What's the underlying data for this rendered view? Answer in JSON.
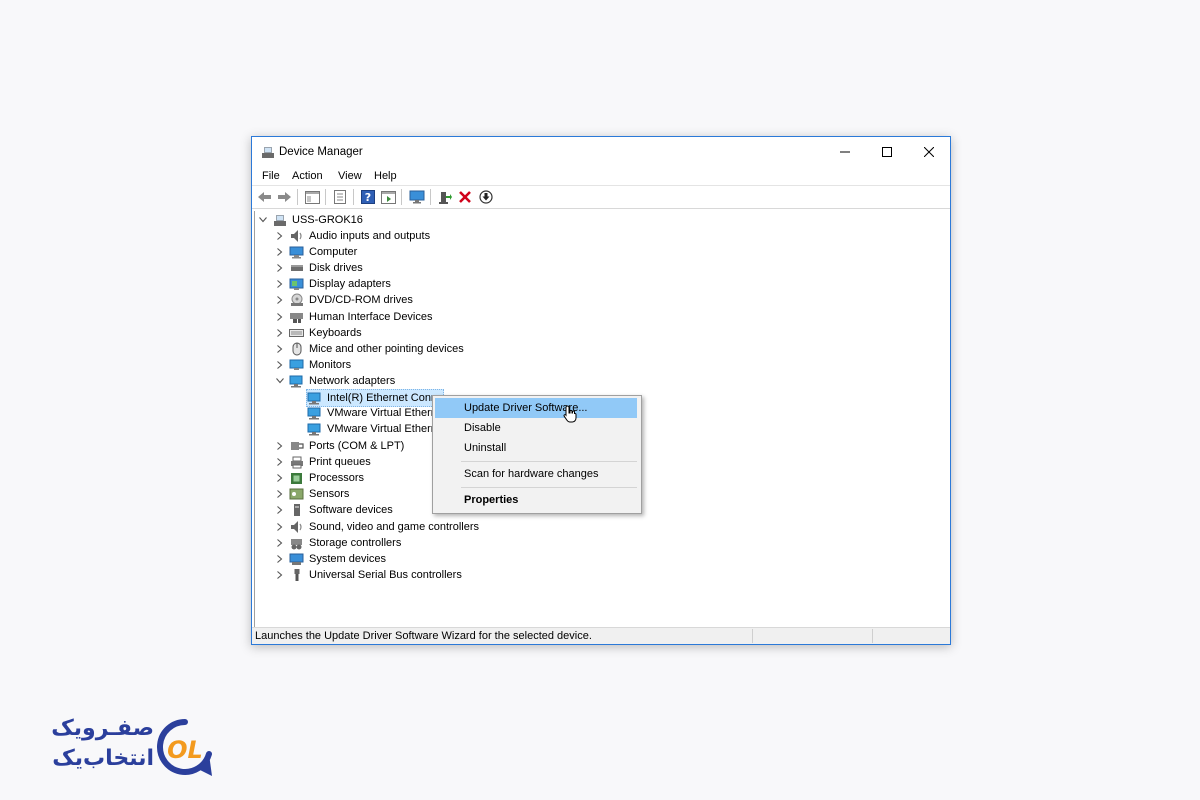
{
  "window": {
    "title": "Device Manager"
  },
  "menu": [
    "File",
    "Action",
    "View",
    "Help"
  ],
  "toolbar": [
    "back-icon",
    "forward-icon",
    "properties-icon",
    "scan-icon",
    "help-icon",
    "action-icon",
    "monitor-icon",
    "update-driver-icon",
    "uninstall-icon",
    "download-icon"
  ],
  "tree": {
    "root": "USS-GROK16",
    "items": [
      {
        "label": "Audio inputs and outputs",
        "icon": "speaker-icon"
      },
      {
        "label": "Computer",
        "icon": "computer-icon"
      },
      {
        "label": "Disk drives",
        "icon": "disk-drive-icon"
      },
      {
        "label": "Display adapters",
        "icon": "display-adapter-icon"
      },
      {
        "label": "DVD/CD-ROM drives",
        "icon": "dvd-drive-icon"
      },
      {
        "label": "Human Interface Devices",
        "icon": "hid-icon"
      },
      {
        "label": "Keyboards",
        "icon": "keyboard-icon"
      },
      {
        "label": "Mice and other pointing devices",
        "icon": "mouse-icon"
      },
      {
        "label": "Monitors",
        "icon": "monitor-icon"
      },
      {
        "label": "Network adapters",
        "icon": "network-adapter-icon"
      }
    ],
    "network_children": [
      "Intel(R) Ethernet Conn",
      "VMware Virtual Ethern",
      "VMware Virtual Ethern"
    ],
    "items_after": [
      {
        "label": "Ports (COM & LPT)",
        "icon": "port-icon"
      },
      {
        "label": "Print queues",
        "icon": "printer-icon"
      },
      {
        "label": "Processors",
        "icon": "processor-icon"
      },
      {
        "label": "Sensors",
        "icon": "sensor-icon"
      },
      {
        "label": "Software devices",
        "icon": "software-device-icon"
      },
      {
        "label": "Sound, video and game controllers",
        "icon": "speaker-icon"
      },
      {
        "label": "Storage controllers",
        "icon": "storage-icon"
      },
      {
        "label": "System devices",
        "icon": "system-icon"
      },
      {
        "label": "Universal Serial Bus controllers",
        "icon": "usb-icon"
      }
    ]
  },
  "context_menu": {
    "update": "Update Driver Software...",
    "disable": "Disable",
    "uninstall": "Uninstall",
    "scan": "Scan for hardware changes",
    "properties": "Properties"
  },
  "status": "Launches the Update Driver Software Wizard for the selected device.",
  "logo": {
    "line1": "صفـرویک",
    "line2": "انتخاب‌یک",
    "mark": "OL"
  },
  "colors": {
    "accent": "#2b79d8",
    "highlight": "#91c9f7",
    "selection": "#cce8ff",
    "logo_blue": "#2b3f9c",
    "logo_orange": "#f39a1e"
  }
}
